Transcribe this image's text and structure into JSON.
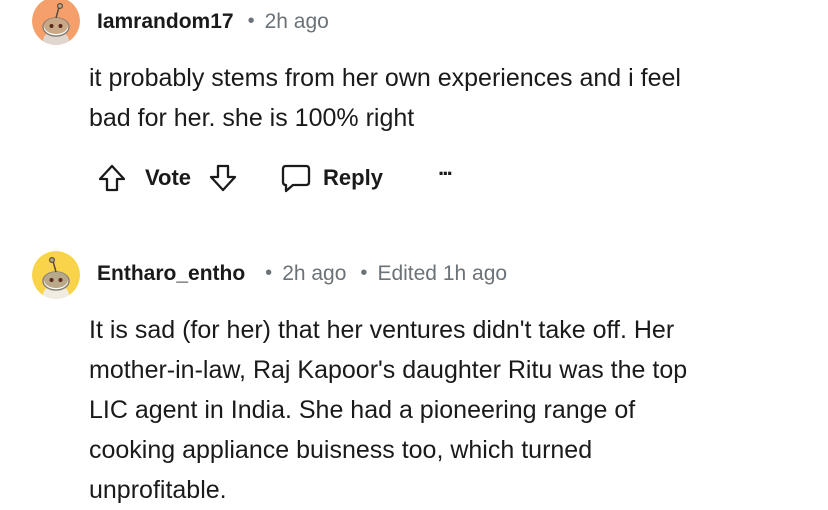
{
  "comments": [
    {
      "avatar_icon": "reddit-snoo-avatar",
      "avatar_color": "#f5a06b",
      "username": "Iamrandom17",
      "time": "2h ago",
      "body": "it probably stems from her own experiences and i feel\nbad for her. she is 100% right",
      "actions": {
        "upvote_icon": "arrow-up-icon",
        "vote_label": "Vote",
        "downvote_icon": "arrow-down-icon",
        "reply_icon": "chat-bubble-icon",
        "reply_label": "Reply",
        "more_label": "···"
      }
    },
    {
      "avatar_icon": "reddit-snoo-avatar",
      "avatar_color": "#f9d34a",
      "username": "Entharo_entho",
      "time": "2h ago",
      "edited": "Edited 1h ago",
      "body": "It is sad (for her) that her ventures didn't take off. Her\nmother-in-law, Raj Kapoor's daughter Ritu was the top\nLIC agent in India. She had a pioneering range of\ncooking appliance buisness too, which turned\nunprofitable."
    }
  ]
}
